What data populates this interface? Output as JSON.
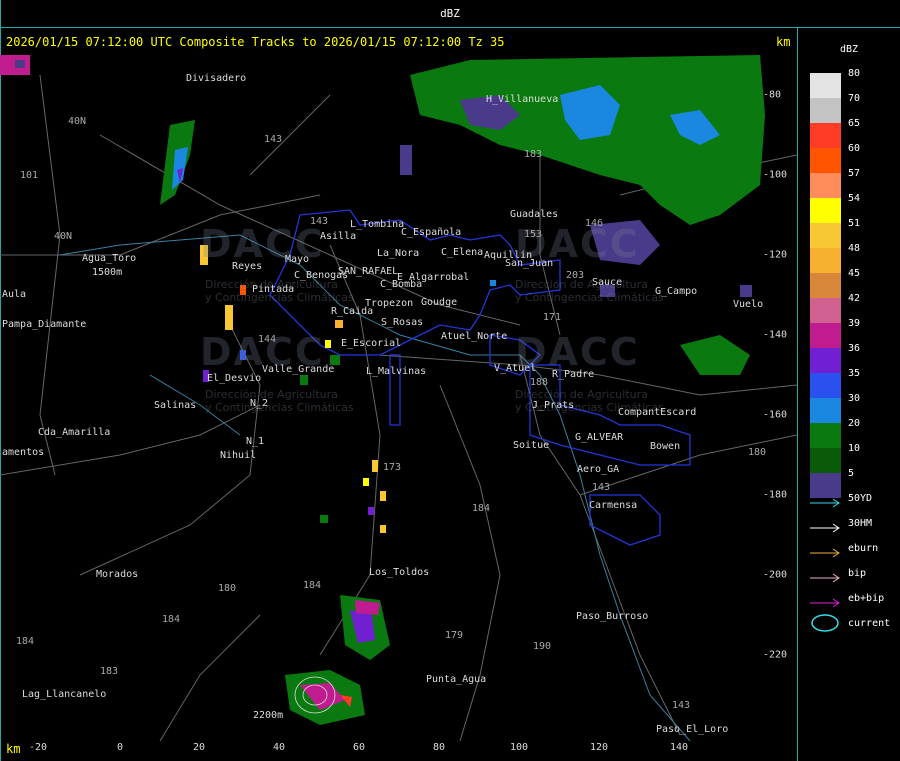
{
  "window": {
    "title": "dBZ"
  },
  "plot": {
    "title": "2026/01/15 07:12:00 UTC Composite Tracks to 2026/01/15 07:12:00 Tz 35",
    "unit": "km"
  },
  "axes": {
    "x_ticks": [
      "-20",
      "0",
      "20",
      "40",
      "60",
      "80",
      "100",
      "120",
      "140"
    ],
    "y_ticks": [
      "-80",
      "-100",
      "-120",
      "-140",
      "-160",
      "-180",
      "-200",
      "-220"
    ]
  },
  "watermark": {
    "logo_text": "DACC",
    "sub_line1": "Dirección de Agricultura",
    "sub_line2": "y Contingencias Climáticas"
  },
  "places": [
    {
      "name": "Divisadero"
    },
    {
      "name": "H_Villanueva"
    },
    {
      "name": "Guadales"
    },
    {
      "name": "L_Tombina"
    },
    {
      "name": "Asilla"
    },
    {
      "name": "C_Española"
    },
    {
      "name": "La_Nora"
    },
    {
      "name": "C_Elena"
    },
    {
      "name": "Aquillin"
    },
    {
      "name": "San_Juan"
    },
    {
      "name": "Agua_Toro"
    },
    {
      "name": "Reyes"
    },
    {
      "name": "Mayo"
    },
    {
      "name": "C_Benogas"
    },
    {
      "name": "SAN_RAFAEL"
    },
    {
      "name": "E_Algarrobal"
    },
    {
      "name": "C_Bomba"
    },
    {
      "name": "Pintada"
    },
    {
      "name": "Tropezon"
    },
    {
      "name": "Goudge"
    },
    {
      "name": "Sauce"
    },
    {
      "name": "G_Campo"
    },
    {
      "name": "Vuelo"
    },
    {
      "name": "Aula"
    },
    {
      "name": "Pampa_Diamante"
    },
    {
      "name": "R_Caida"
    },
    {
      "name": "S_Rosas"
    },
    {
      "name": "Atuel_Norte"
    },
    {
      "name": "E_Escorial"
    },
    {
      "name": "Valle_Grande"
    },
    {
      "name": "L_Malvinas"
    },
    {
      "name": "V_Atuel"
    },
    {
      "name": "R_Padre"
    },
    {
      "name": "El_Desvio"
    },
    {
      "name": "Salinas"
    },
    {
      "name": "N_2"
    },
    {
      "name": "J_Prats"
    },
    {
      "name": "CompantEscard"
    },
    {
      "name": "Cda_Amarilla"
    },
    {
      "name": "N_1"
    },
    {
      "name": "G_ALVEAR"
    },
    {
      "name": "Soitue"
    },
    {
      "name": "Bowen"
    },
    {
      "name": "amentos"
    },
    {
      "name": "Nihuil"
    },
    {
      "name": "Aero_GA"
    },
    {
      "name": "Carmensa"
    },
    {
      "name": "Morados"
    },
    {
      "name": "Los_Toldos"
    },
    {
      "name": "Paso_Burroso"
    },
    {
      "name": "Lag_Llancanelo"
    },
    {
      "name": "Punta_Agua"
    },
    {
      "name": "Paso_El_Loro"
    },
    {
      "name": "1500m"
    },
    {
      "name": "2200m"
    }
  ],
  "routes": [
    {
      "name": "40N"
    },
    {
      "name": "101"
    },
    {
      "name": "143"
    },
    {
      "name": "40N"
    },
    {
      "name": "143"
    },
    {
      "name": "153"
    },
    {
      "name": "146"
    },
    {
      "name": "203"
    },
    {
      "name": "171"
    },
    {
      "name": "144"
    },
    {
      "name": "173"
    },
    {
      "name": "184"
    },
    {
      "name": "180"
    },
    {
      "name": "184"
    },
    {
      "name": "184"
    },
    {
      "name": "183"
    },
    {
      "name": "179"
    },
    {
      "name": "190"
    },
    {
      "name": "184"
    },
    {
      "name": "143"
    },
    {
      "name": "143"
    },
    {
      "name": "188"
    },
    {
      "name": "180"
    },
    {
      "name": "183"
    }
  ],
  "legend": {
    "title": "dBZ",
    "levels": [
      {
        "label": "80",
        "color": "#e4e4e4"
      },
      {
        "label": "70",
        "color": "#c3c3c3"
      },
      {
        "label": "65",
        "color": "#ff3a25"
      },
      {
        "label": "60",
        "color": "#ff5500"
      },
      {
        "label": "57",
        "color": "#ff8c5a"
      },
      {
        "label": "54",
        "color": "#ffff00"
      },
      {
        "label": "51",
        "color": "#f8c833"
      },
      {
        "label": "48",
        "color": "#f8b030"
      },
      {
        "label": "45",
        "color": "#d8863a"
      },
      {
        "label": "42",
        "color": "#d06090"
      },
      {
        "label": "39",
        "color": "#c01c90"
      },
      {
        "label": "36",
        "color": "#7020d0"
      },
      {
        "label": "35",
        "color": "#2a50f0"
      },
      {
        "label": "30",
        "color": "#1a88e0"
      },
      {
        "label": "20",
        "color": "#0a7a10"
      },
      {
        "label": "10",
        "color": "#0a5a0a"
      },
      {
        "label": "5",
        "color": "#4a3a8a"
      }
    ],
    "tracks": [
      {
        "label": "50YD",
        "color": "#33dde8"
      },
      {
        "label": "30HM",
        "color": "#ffffff"
      },
      {
        "label": "eburn",
        "color": "#f0b040"
      },
      {
        "label": "bip",
        "color": "#f0b0d0"
      },
      {
        "label": "eb+bip",
        "color": "#e020e0"
      }
    ],
    "current": {
      "label": "current",
      "color": "#33dde8"
    }
  }
}
